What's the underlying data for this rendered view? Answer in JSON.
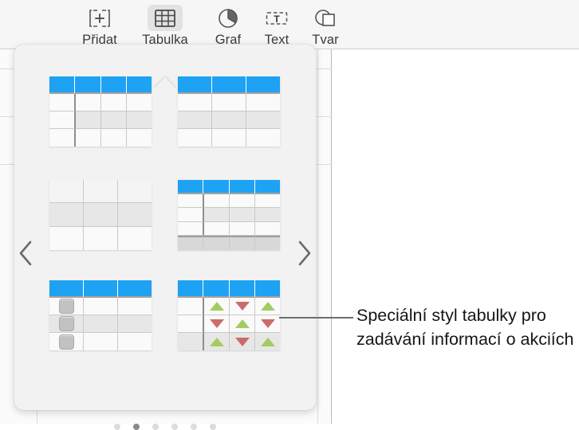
{
  "toolbar": {
    "items": [
      {
        "label": "Přidat",
        "icon": "add-box-icon",
        "selected": false
      },
      {
        "label": "Tabulka",
        "icon": "table-icon",
        "selected": true
      },
      {
        "label": "Graf",
        "icon": "pie-chart-icon",
        "selected": false
      },
      {
        "label": "Text",
        "icon": "text-box-icon",
        "selected": false
      },
      {
        "label": "Tvar",
        "icon": "shape-icon",
        "selected": false
      }
    ]
  },
  "popover": {
    "prev_arrow": "chevron-left-icon",
    "next_arrow": "chevron-right-icon",
    "accent_blue": "#1ea2f3",
    "up_arrow_color": "#a3cc62",
    "down_arrow_color": "#cc6b6b",
    "thumbnails": [
      {
        "name": "basic-table-4col",
        "columns": 4,
        "header_row": true,
        "body_rows": 3,
        "first_column_separator": true,
        "footer_row": false,
        "checkboxes": false,
        "arrows": null
      },
      {
        "name": "basic-table-3col",
        "columns": 3,
        "header_row": true,
        "body_rows": 3,
        "first_column_separator": false,
        "footer_row": false,
        "checkboxes": false,
        "arrows": null
      },
      {
        "name": "plain-table-3col",
        "columns": 3,
        "header_row": false,
        "body_rows": 3,
        "first_column_separator": false,
        "footer_row": false,
        "checkboxes": false,
        "arrows": null
      },
      {
        "name": "table-with-footer-4col",
        "columns": 4,
        "header_row": true,
        "body_rows": 3,
        "first_column_separator": true,
        "footer_row": true,
        "checkboxes": false,
        "arrows": null
      },
      {
        "name": "checklist-table-3col",
        "columns": 3,
        "header_row": true,
        "body_rows": 3,
        "first_column_separator": false,
        "footer_row": false,
        "checkboxes": true,
        "arrows": null
      },
      {
        "name": "stocks-table-4col",
        "columns": 4,
        "header_row": true,
        "body_rows": 3,
        "first_column_separator": true,
        "footer_row": false,
        "checkboxes": false,
        "arrows": [
          [
            null,
            "up",
            "down",
            "up"
          ],
          [
            null,
            "down",
            "up",
            "down"
          ],
          [
            null,
            "up",
            "down",
            "up"
          ]
        ]
      }
    ],
    "page_dots": {
      "count": 6,
      "active_index": 1
    }
  },
  "callout": {
    "text": "Speciální styl tabulky pro zadávání informací o akciích"
  }
}
